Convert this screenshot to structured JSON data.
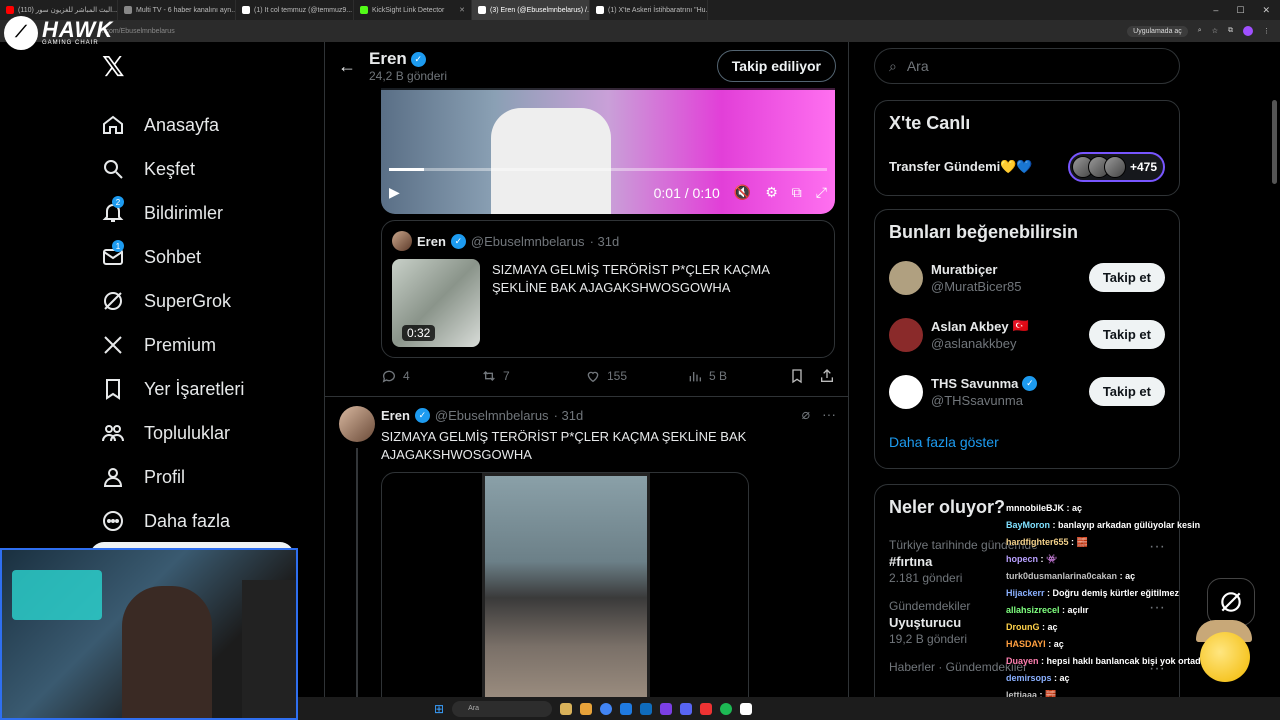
{
  "browser": {
    "tabs": [
      {
        "title": "(110) البث المباشر للغزيون سور...",
        "color": "#ff0000",
        "active": false
      },
      {
        "title": "Multi TV - 6 haber kanalını ayn...",
        "color": "#888888",
        "active": false
      },
      {
        "title": "(1) It col temmuz (@temmuz9...",
        "color": "#ffffff",
        "active": false
      },
      {
        "title": "KickSight Link Detector",
        "color": "#53fc18",
        "active": false
      },
      {
        "title": "(3) Eren (@Ebuselmnbelarus) /...",
        "color": "#ffffff",
        "active": true
      },
      {
        "title": "(1) X'te Askeri İstihbaratrını \"Hu...",
        "color": "#ffffff",
        "active": false
      }
    ],
    "url": "x.com/Ebuselmnbelarus",
    "open_in_app": "Uygulamada aç"
  },
  "overlay": {
    "brand": "HAWK",
    "brand_sub": "GAMING CHAIR"
  },
  "nav": {
    "items": [
      {
        "label": "Anasayfa",
        "icon": "home-icon",
        "badge": ""
      },
      {
        "label": "Keşfet",
        "icon": "search-icon",
        "badge": ""
      },
      {
        "label": "Bildirimler",
        "icon": "bell-icon",
        "badge": "2"
      },
      {
        "label": "Sohbet",
        "icon": "mail-icon",
        "badge": "1"
      },
      {
        "label": "SuperGrok",
        "icon": "grok-icon",
        "badge": ""
      },
      {
        "label": "Premium",
        "icon": "x-icon",
        "badge": ""
      },
      {
        "label": "Yer İşaretleri",
        "icon": "bookmark-icon",
        "badge": ""
      },
      {
        "label": "Topluluklar",
        "icon": "people-icon",
        "badge": ""
      },
      {
        "label": "Profil",
        "icon": "person-icon",
        "badge": ""
      },
      {
        "label": "Daha fazla",
        "icon": "more-icon",
        "badge": ""
      }
    ]
  },
  "header": {
    "name": "Eren",
    "posts": "24,2 B gönderi",
    "follow_label": "Takip ediliyor"
  },
  "video": {
    "time": "0:01 / 0:10",
    "progress": 0.08
  },
  "quote": {
    "name": "Eren",
    "handle": "@Ebuselmnbelarus",
    "age": "· 31d",
    "duration": "0:32",
    "text": "SIZMAYA GELMİŞ TERÖRİST P*ÇLER KAÇMA ŞEKLİNE BAK AJAGAKSHWOSGOWHA"
  },
  "actions": {
    "replies": "4",
    "reposts": "7",
    "likes": "155",
    "views": "5 B"
  },
  "post2": {
    "name": "Eren",
    "handle": "@Ebuselmnbelarus",
    "age": "· 31d",
    "text": "SIZMAYA GELMİŞ TERÖRİST P*ÇLER KAÇMA ŞEKLİNE BAK AJAGAKSHWOSGOWHA"
  },
  "right": {
    "search_placeholder": "Ara",
    "live": {
      "title": "X'te Canlı",
      "topic": "Transfer Gündemi💛💙",
      "count": "+475"
    },
    "suggestions": {
      "title": "Bunları beğenebilirsin",
      "items": [
        {
          "name": "Muratbiçer",
          "handle": "@MuratBicer85",
          "badge": "",
          "button": "Takip et",
          "color": "#b0a080"
        },
        {
          "name": "Aslan Akbey",
          "handle": "@aslanakkbey",
          "badge": "🇹🇷",
          "button": "Takip et",
          "color": "#8a2a2a"
        },
        {
          "name": "THS Savunma",
          "handle": "@THSsavunma",
          "badge": "verified",
          "button": "Takip et",
          "color": "#ffffff"
        }
      ],
      "more": "Daha fazla göster"
    },
    "trends": {
      "title": "Neler oluyor?",
      "items": [
        {
          "context": "Türkiye tarihinde gündemde",
          "title": "#fırtına",
          "count": "2.181 gönderi"
        },
        {
          "context": "Gündemdekiler",
          "title": "Uyuşturucu",
          "count": "19,2 B gönderi"
        },
        {
          "context": "Haberler · Gündemdekiler",
          "title": "",
          "count": ""
        }
      ]
    }
  },
  "chat": [
    {
      "user": "mnnobileBJK",
      "msg": "aç",
      "color": "#ffffff"
    },
    {
      "user": "BayMoron",
      "msg": "banlayıp arkadan gülüyolar kesin",
      "color": "#7fe0ff"
    },
    {
      "user": "hardfighter655",
      "msg": "🧱",
      "color": "#f2d08a"
    },
    {
      "user": "hopecn",
      "msg": "👾",
      "color": "#b8a0ff"
    },
    {
      "user": "turk0dusmanlarina0cakan",
      "msg": "aç",
      "color": "#c0c0c0"
    },
    {
      "user": "Hijackerr",
      "msg": "Doğru demiş kürtler eğitilmez",
      "color": "#8ab0ff"
    },
    {
      "user": "allahsizrecel",
      "msg": "açılır",
      "color": "#7fff7f"
    },
    {
      "user": "DrounG",
      "msg": "aç",
      "color": "#ffd24a"
    },
    {
      "user": "HASDAYI",
      "msg": "aç",
      "color": "#ff9f40"
    },
    {
      "user": "Duayen",
      "msg": "hepsi haklı banlancak bişi yok ortada",
      "color": "#ff7fb0"
    },
    {
      "user": "demirsops",
      "msg": "aç",
      "color": "#8ab0ff"
    },
    {
      "user": "lettiaaa",
      "msg": "🧱",
      "color": "#c0c0c0"
    }
  ],
  "taskbar": {
    "search": "Ara"
  },
  "colors": {
    "accent": "#1d9bf0",
    "background": "#000000",
    "border": "#2f3336",
    "muted": "#71767b"
  }
}
